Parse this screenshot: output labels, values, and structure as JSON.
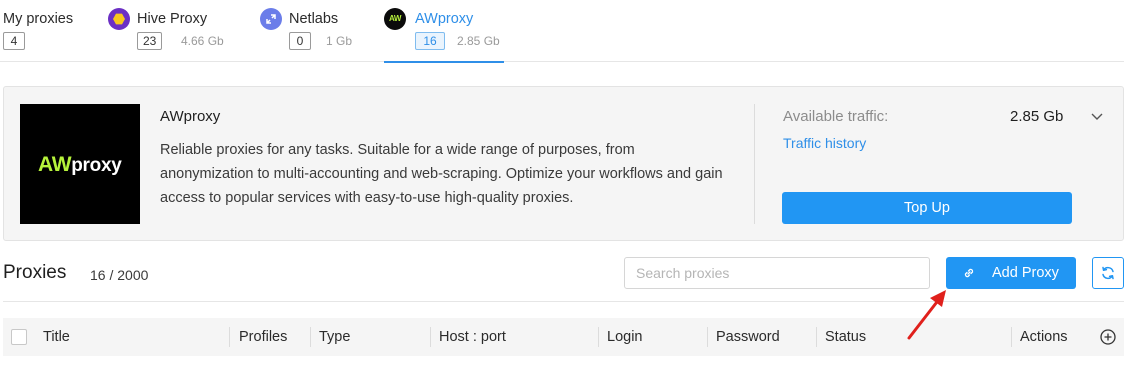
{
  "tabs": [
    {
      "title": "My proxies",
      "count": "4",
      "traffic": ""
    },
    {
      "title": "Hive Proxy",
      "count": "23",
      "traffic": "4.66 Gb",
      "icon": "hive-proxy-icon"
    },
    {
      "title": "Netlabs",
      "count": "0",
      "traffic": "1 Gb",
      "icon": "netlabs-icon"
    },
    {
      "title": "AWproxy",
      "count": "16",
      "traffic": "2.85 Gb",
      "icon": "awproxy-icon",
      "active": true
    }
  ],
  "provider": {
    "logo_accent": "AW",
    "logo_rest": "proxy",
    "name": "AWproxy",
    "description": "Reliable proxies for any tasks. Suitable for a wide range of purposes, from anonymization to multi-accounting and web-scraping. Optimize your workflows and gain access to popular services with easy-to-use high-quality proxies.",
    "available_label": "Available traffic:",
    "available_value": "2.85 Gb",
    "history_link": "Traffic history",
    "topup_label": "Top Up"
  },
  "proxies": {
    "title": "Proxies",
    "count": "16 / 2000",
    "search_placeholder": "Search proxies",
    "add_label": "Add Proxy"
  },
  "table": {
    "columns": [
      "Title",
      "Profiles",
      "Type",
      "Host : port",
      "Login",
      "Password",
      "Status",
      "Actions"
    ]
  },
  "colors": {
    "accent": "#2196f3",
    "link": "#2f8fe8",
    "aw_green": "#b6f23b",
    "annotation_arrow": "#e0201c"
  }
}
